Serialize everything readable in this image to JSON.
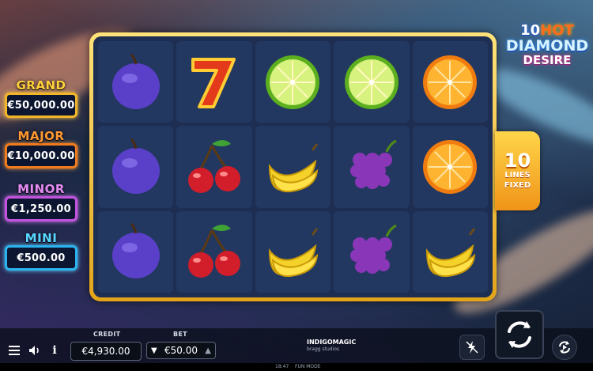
{
  "game": {
    "logo_line1_num": "10",
    "logo_line1_word": "HOT",
    "logo_line2": "DIAMOND",
    "logo_line3": "DESIRE"
  },
  "jackpots": [
    {
      "name": "GRAND",
      "amount": "€50,000.00"
    },
    {
      "name": "MAJOR",
      "amount": "€10,000.00"
    },
    {
      "name": "MINOR",
      "amount": "€1,250.00"
    },
    {
      "name": "MINI",
      "amount": "€500.00"
    }
  ],
  "lines": {
    "count": "10",
    "label1": "LINES",
    "label2": "FIXED"
  },
  "reels": [
    [
      "plum",
      "plum",
      "plum"
    ],
    [
      "seven",
      "cherry",
      "cherry"
    ],
    [
      "lime",
      "banana",
      "banana"
    ],
    [
      "lime",
      "grapes",
      "grapes"
    ],
    [
      "orange",
      "orange",
      "banana"
    ]
  ],
  "controls": {
    "credit_label": "CREDIT",
    "credit_value": "€4,930.00",
    "bet_label": "BET",
    "bet_value": "€50.00",
    "brand_name": "INDIGOMAGIC",
    "brand_sub": "bragg studios"
  },
  "status": {
    "time": "18:47",
    "mode": "FUN MODE"
  },
  "icons": [
    "menu-icon",
    "volume-icon",
    "info-icon",
    "bet-down-icon",
    "bet-up-icon",
    "turbo-icon",
    "spin-icon",
    "autoplay-icon"
  ]
}
